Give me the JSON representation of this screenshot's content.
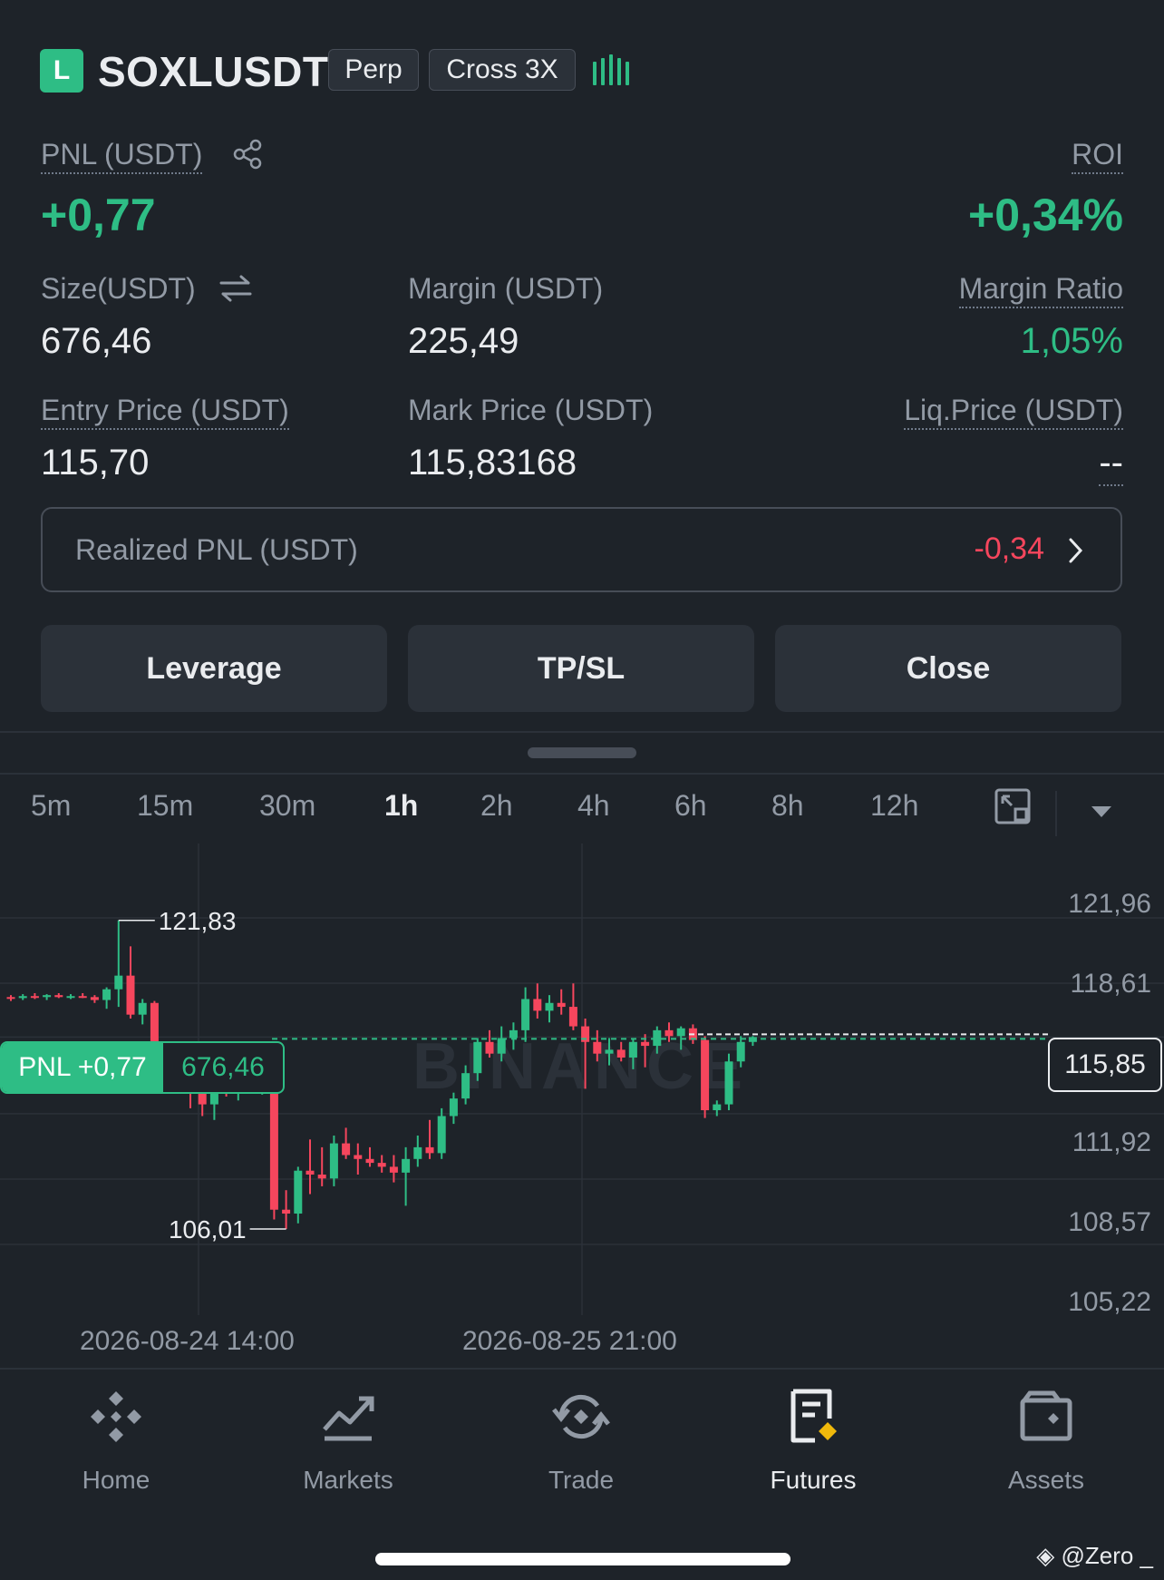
{
  "header": {
    "side_badge": "L",
    "symbol": "SOXLUSDT",
    "type_tag": "Perp",
    "margin_tag": "Cross 3X"
  },
  "pnl": {
    "label": "PNL (USDT)",
    "value": "+0,77"
  },
  "roi": {
    "label": "ROI",
    "value": "+0,34%"
  },
  "size": {
    "label": "Size(USDT)",
    "value": "676,46"
  },
  "margin": {
    "label": "Margin (USDT)",
    "value": "225,49"
  },
  "margin_ratio": {
    "label": "Margin Ratio",
    "value": "1,05%"
  },
  "entry_price": {
    "label": "Entry Price (USDT)",
    "value": "115,70"
  },
  "mark_price": {
    "label": "Mark Price (USDT)",
    "value": "115,83168"
  },
  "liq_price": {
    "label": "Liq.Price (USDT)",
    "value": "--"
  },
  "realized_pnl": {
    "label": "Realized PNL (USDT)",
    "value": "-0,34"
  },
  "actions": {
    "leverage": "Leverage",
    "tpsl": "TP/SL",
    "close": "Close"
  },
  "timeframes": [
    "5m",
    "15m",
    "30m",
    "1h",
    "2h",
    "4h",
    "6h",
    "8h",
    "12h"
  ],
  "active_timeframe": "1h",
  "chart_data": {
    "type": "candlestick",
    "y_axis_ticks": [
      "121,96",
      "118,61",
      "115,85",
      "111,92",
      "108,57",
      "105,22"
    ],
    "current_price": "115,85",
    "high_marker": "121,83",
    "low_marker": "106,01",
    "x_labels": [
      "2026-08-24 14:00",
      "2026-08-25 21:00"
    ],
    "position_pill": {
      "pnl": "PNL +0,77",
      "size": "676,46"
    },
    "watermark": "BINANCE",
    "ylim": [
      105.22,
      121.96
    ],
    "candles": [
      {
        "o": 117.9,
        "h": 118.0,
        "l": 117.7,
        "c": 117.85
      },
      {
        "o": 117.85,
        "h": 118.05,
        "l": 117.75,
        "c": 117.95
      },
      {
        "o": 117.95,
        "h": 118.1,
        "l": 117.8,
        "c": 117.9
      },
      {
        "o": 117.9,
        "h": 118.05,
        "l": 117.75,
        "c": 118.0
      },
      {
        "o": 118.0,
        "h": 118.1,
        "l": 117.85,
        "c": 117.9
      },
      {
        "o": 117.9,
        "h": 118.05,
        "l": 117.8,
        "c": 117.95
      },
      {
        "o": 117.95,
        "h": 118.1,
        "l": 117.85,
        "c": 117.9
      },
      {
        "o": 117.9,
        "h": 118.0,
        "l": 117.6,
        "c": 117.75
      },
      {
        "o": 117.75,
        "h": 118.4,
        "l": 117.3,
        "c": 118.3
      },
      {
        "o": 118.3,
        "h": 121.83,
        "l": 117.4,
        "c": 119.0
      },
      {
        "o": 119.0,
        "h": 120.5,
        "l": 116.8,
        "c": 117.0
      },
      {
        "o": 117.0,
        "h": 117.8,
        "l": 116.5,
        "c": 117.6
      },
      {
        "o": 117.6,
        "h": 117.7,
        "l": 115.0,
        "c": 115.2
      },
      {
        "o": 115.2,
        "h": 115.6,
        "l": 114.6,
        "c": 115.0
      },
      {
        "o": 115.0,
        "h": 115.4,
        "l": 113.2,
        "c": 114.0
      },
      {
        "o": 114.0,
        "h": 114.5,
        "l": 112.2,
        "c": 113.0
      },
      {
        "o": 113.0,
        "h": 113.8,
        "l": 111.8,
        "c": 112.4
      },
      {
        "o": 112.4,
        "h": 113.8,
        "l": 111.6,
        "c": 113.5
      },
      {
        "o": 113.5,
        "h": 114.4,
        "l": 112.8,
        "c": 113.2
      },
      {
        "o": 113.2,
        "h": 114.0,
        "l": 112.6,
        "c": 113.8
      },
      {
        "o": 113.8,
        "h": 114.2,
        "l": 113.0,
        "c": 113.3
      },
      {
        "o": 113.3,
        "h": 113.9,
        "l": 112.9,
        "c": 113.6
      },
      {
        "o": 113.6,
        "h": 113.8,
        "l": 106.5,
        "c": 107.0
      },
      {
        "o": 107.0,
        "h": 108.0,
        "l": 106.01,
        "c": 106.8
      },
      {
        "o": 106.8,
        "h": 109.2,
        "l": 106.3,
        "c": 109.0
      },
      {
        "o": 109.0,
        "h": 110.6,
        "l": 107.8,
        "c": 108.8
      },
      {
        "o": 108.8,
        "h": 110.2,
        "l": 108.2,
        "c": 108.6
      },
      {
        "o": 108.6,
        "h": 110.8,
        "l": 108.2,
        "c": 110.4
      },
      {
        "o": 110.4,
        "h": 111.2,
        "l": 109.6,
        "c": 109.8
      },
      {
        "o": 109.8,
        "h": 110.4,
        "l": 108.8,
        "c": 109.6
      },
      {
        "o": 109.6,
        "h": 110.2,
        "l": 109.2,
        "c": 109.4
      },
      {
        "o": 109.4,
        "h": 109.8,
        "l": 108.9,
        "c": 109.2
      },
      {
        "o": 109.2,
        "h": 109.8,
        "l": 108.4,
        "c": 108.9
      },
      {
        "o": 108.9,
        "h": 110.2,
        "l": 107.2,
        "c": 109.6
      },
      {
        "o": 109.6,
        "h": 110.8,
        "l": 109.2,
        "c": 110.2
      },
      {
        "o": 110.2,
        "h": 111.6,
        "l": 109.6,
        "c": 109.9
      },
      {
        "o": 109.9,
        "h": 112.2,
        "l": 109.6,
        "c": 111.8
      },
      {
        "o": 111.8,
        "h": 113.0,
        "l": 111.4,
        "c": 112.7
      },
      {
        "o": 112.7,
        "h": 114.4,
        "l": 112.4,
        "c": 114.0
      },
      {
        "o": 114.0,
        "h": 115.8,
        "l": 113.6,
        "c": 115.6
      },
      {
        "o": 115.6,
        "h": 116.2,
        "l": 114.8,
        "c": 115.0
      },
      {
        "o": 115.0,
        "h": 116.4,
        "l": 114.6,
        "c": 115.8
      },
      {
        "o": 115.8,
        "h": 116.6,
        "l": 115.2,
        "c": 116.2
      },
      {
        "o": 116.2,
        "h": 118.4,
        "l": 115.6,
        "c": 117.8
      },
      {
        "o": 117.8,
        "h": 118.6,
        "l": 116.8,
        "c": 117.2
      },
      {
        "o": 117.2,
        "h": 118.0,
        "l": 116.6,
        "c": 117.6
      },
      {
        "o": 117.6,
        "h": 118.3,
        "l": 117.0,
        "c": 117.4
      },
      {
        "o": 117.4,
        "h": 118.6,
        "l": 116.2,
        "c": 116.4
      },
      {
        "o": 116.4,
        "h": 116.8,
        "l": 113.2,
        "c": 115.6
      },
      {
        "o": 115.6,
        "h": 116.2,
        "l": 114.6,
        "c": 115.0
      },
      {
        "o": 115.0,
        "h": 115.8,
        "l": 114.4,
        "c": 115.2
      },
      {
        "o": 115.2,
        "h": 115.6,
        "l": 114.6,
        "c": 114.8
      },
      {
        "o": 114.8,
        "h": 115.8,
        "l": 114.2,
        "c": 115.6
      },
      {
        "o": 115.6,
        "h": 116.0,
        "l": 114.3,
        "c": 115.4
      },
      {
        "o": 115.4,
        "h": 116.4,
        "l": 115.0,
        "c": 116.2
      },
      {
        "o": 116.2,
        "h": 116.6,
        "l": 115.6,
        "c": 115.9
      },
      {
        "o": 115.9,
        "h": 116.4,
        "l": 115.2,
        "c": 116.3
      },
      {
        "o": 116.3,
        "h": 116.5,
        "l": 115.5,
        "c": 115.7
      },
      {
        "o": 115.7,
        "h": 115.9,
        "l": 111.7,
        "c": 112.1
      },
      {
        "o": 112.1,
        "h": 112.6,
        "l": 111.8,
        "c": 112.4
      },
      {
        "o": 112.4,
        "h": 115.0,
        "l": 112.1,
        "c": 114.6
      },
      {
        "o": 114.6,
        "h": 115.9,
        "l": 114.3,
        "c": 115.6
      },
      {
        "o": 115.6,
        "h": 115.9,
        "l": 115.4,
        "c": 115.85
      }
    ]
  },
  "bottom_nav": {
    "items": [
      {
        "label": "Home",
        "icon": "binance-logo-icon"
      },
      {
        "label": "Markets",
        "icon": "chart-trend-icon"
      },
      {
        "label": "Trade",
        "icon": "swap-cycle-icon"
      },
      {
        "label": "Futures",
        "icon": "futures-doc-icon"
      },
      {
        "label": "Assets",
        "icon": "wallet-icon"
      }
    ],
    "active": "Futures"
  },
  "watermark_corner": "@Zero _",
  "colors": {
    "bg": "#1e2329",
    "green": "#2ebd85",
    "red": "#f6465d",
    "muted": "#929aa5",
    "text": "#eaecef",
    "accent": "#f0b90b"
  }
}
